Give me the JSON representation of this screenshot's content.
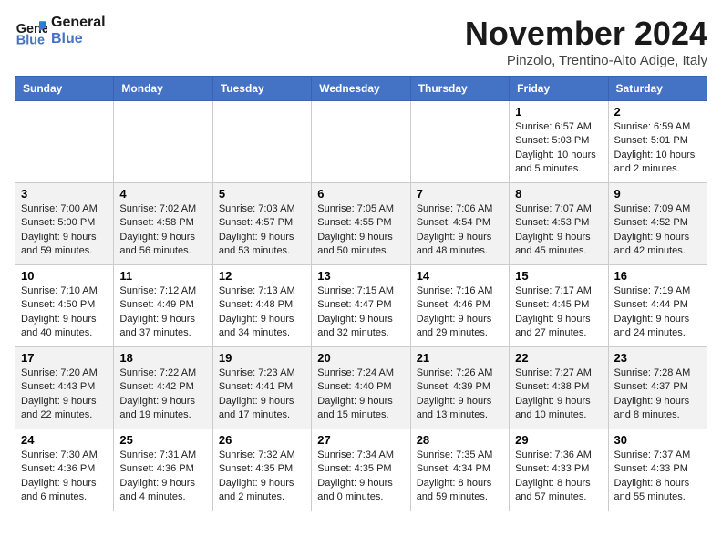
{
  "header": {
    "logo": {
      "line1": "General",
      "line2": "Blue"
    },
    "title": "November 2024",
    "location": "Pinzolo, Trentino-Alto Adige, Italy"
  },
  "weekdays": [
    "Sunday",
    "Monday",
    "Tuesday",
    "Wednesday",
    "Thursday",
    "Friday",
    "Saturday"
  ],
  "weeks": [
    [
      {
        "day": null,
        "info": null
      },
      {
        "day": null,
        "info": null
      },
      {
        "day": null,
        "info": null
      },
      {
        "day": null,
        "info": null
      },
      {
        "day": null,
        "info": null
      },
      {
        "day": "1",
        "info": "Sunrise: 6:57 AM\nSunset: 5:03 PM\nDaylight: 10 hours\nand 5 minutes."
      },
      {
        "day": "2",
        "info": "Sunrise: 6:59 AM\nSunset: 5:01 PM\nDaylight: 10 hours\nand 2 minutes."
      }
    ],
    [
      {
        "day": "3",
        "info": "Sunrise: 7:00 AM\nSunset: 5:00 PM\nDaylight: 9 hours\nand 59 minutes."
      },
      {
        "day": "4",
        "info": "Sunrise: 7:02 AM\nSunset: 4:58 PM\nDaylight: 9 hours\nand 56 minutes."
      },
      {
        "day": "5",
        "info": "Sunrise: 7:03 AM\nSunset: 4:57 PM\nDaylight: 9 hours\nand 53 minutes."
      },
      {
        "day": "6",
        "info": "Sunrise: 7:05 AM\nSunset: 4:55 PM\nDaylight: 9 hours\nand 50 minutes."
      },
      {
        "day": "7",
        "info": "Sunrise: 7:06 AM\nSunset: 4:54 PM\nDaylight: 9 hours\nand 48 minutes."
      },
      {
        "day": "8",
        "info": "Sunrise: 7:07 AM\nSunset: 4:53 PM\nDaylight: 9 hours\nand 45 minutes."
      },
      {
        "day": "9",
        "info": "Sunrise: 7:09 AM\nSunset: 4:52 PM\nDaylight: 9 hours\nand 42 minutes."
      }
    ],
    [
      {
        "day": "10",
        "info": "Sunrise: 7:10 AM\nSunset: 4:50 PM\nDaylight: 9 hours\nand 40 minutes."
      },
      {
        "day": "11",
        "info": "Sunrise: 7:12 AM\nSunset: 4:49 PM\nDaylight: 9 hours\nand 37 minutes."
      },
      {
        "day": "12",
        "info": "Sunrise: 7:13 AM\nSunset: 4:48 PM\nDaylight: 9 hours\nand 34 minutes."
      },
      {
        "day": "13",
        "info": "Sunrise: 7:15 AM\nSunset: 4:47 PM\nDaylight: 9 hours\nand 32 minutes."
      },
      {
        "day": "14",
        "info": "Sunrise: 7:16 AM\nSunset: 4:46 PM\nDaylight: 9 hours\nand 29 minutes."
      },
      {
        "day": "15",
        "info": "Sunrise: 7:17 AM\nSunset: 4:45 PM\nDaylight: 9 hours\nand 27 minutes."
      },
      {
        "day": "16",
        "info": "Sunrise: 7:19 AM\nSunset: 4:44 PM\nDaylight: 9 hours\nand 24 minutes."
      }
    ],
    [
      {
        "day": "17",
        "info": "Sunrise: 7:20 AM\nSunset: 4:43 PM\nDaylight: 9 hours\nand 22 minutes."
      },
      {
        "day": "18",
        "info": "Sunrise: 7:22 AM\nSunset: 4:42 PM\nDaylight: 9 hours\nand 19 minutes."
      },
      {
        "day": "19",
        "info": "Sunrise: 7:23 AM\nSunset: 4:41 PM\nDaylight: 9 hours\nand 17 minutes."
      },
      {
        "day": "20",
        "info": "Sunrise: 7:24 AM\nSunset: 4:40 PM\nDaylight: 9 hours\nand 15 minutes."
      },
      {
        "day": "21",
        "info": "Sunrise: 7:26 AM\nSunset: 4:39 PM\nDaylight: 9 hours\nand 13 minutes."
      },
      {
        "day": "22",
        "info": "Sunrise: 7:27 AM\nSunset: 4:38 PM\nDaylight: 9 hours\nand 10 minutes."
      },
      {
        "day": "23",
        "info": "Sunrise: 7:28 AM\nSunset: 4:37 PM\nDaylight: 9 hours\nand 8 minutes."
      }
    ],
    [
      {
        "day": "24",
        "info": "Sunrise: 7:30 AM\nSunset: 4:36 PM\nDaylight: 9 hours\nand 6 minutes."
      },
      {
        "day": "25",
        "info": "Sunrise: 7:31 AM\nSunset: 4:36 PM\nDaylight: 9 hours\nand 4 minutes."
      },
      {
        "day": "26",
        "info": "Sunrise: 7:32 AM\nSunset: 4:35 PM\nDaylight: 9 hours\nand 2 minutes."
      },
      {
        "day": "27",
        "info": "Sunrise: 7:34 AM\nSunset: 4:35 PM\nDaylight: 9 hours\nand 0 minutes."
      },
      {
        "day": "28",
        "info": "Sunrise: 7:35 AM\nSunset: 4:34 PM\nDaylight: 8 hours\nand 59 minutes."
      },
      {
        "day": "29",
        "info": "Sunrise: 7:36 AM\nSunset: 4:33 PM\nDaylight: 8 hours\nand 57 minutes."
      },
      {
        "day": "30",
        "info": "Sunrise: 7:37 AM\nSunset: 4:33 PM\nDaylight: 8 hours\nand 55 minutes."
      }
    ]
  ]
}
